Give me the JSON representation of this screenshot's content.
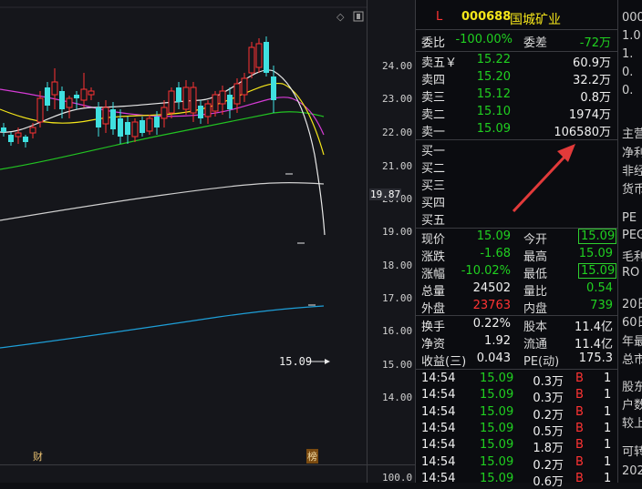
{
  "header": {
    "marker": "L",
    "code": "000688",
    "name": "国城矿业",
    "weibi_label": "委比",
    "weibi_value": "-100.00%",
    "weicha_label": "委差",
    "weicha_value": "-72万"
  },
  "asks": [
    {
      "label": "卖五￥",
      "price": "15.22",
      "vol": "60.9万"
    },
    {
      "label": "卖四",
      "price": "15.20",
      "vol": "32.2万"
    },
    {
      "label": "卖三",
      "price": "15.12",
      "vol": "0.8万"
    },
    {
      "label": "卖二",
      "price": "15.10",
      "vol": "1974万"
    },
    {
      "label": "卖一",
      "price": "15.09",
      "vol": "106580万"
    }
  ],
  "bids": [
    "买一",
    "买二",
    "买三",
    "买四",
    "买五"
  ],
  "stats": [
    {
      "l1": "现价",
      "v1": "15.09",
      "c1": "green",
      "l2": "今开",
      "v2": "15.09",
      "c2": "green",
      "b2": true
    },
    {
      "l1": "涨跌",
      "v1": "-1.68",
      "c1": "green",
      "l2": "最高",
      "v2": "15.09",
      "c2": "green",
      "b2": false
    },
    {
      "l1": "涨幅",
      "v1": "-10.02%",
      "c1": "green",
      "l2": "最低",
      "v2": "15.09",
      "c2": "green",
      "b2": true
    },
    {
      "l1": "总量",
      "v1": "24502",
      "c1": "white",
      "l2": "量比",
      "v2": "0.54",
      "c2": "green",
      "b2": false
    },
    {
      "l1": "外盘",
      "v1": "23763",
      "c1": "red",
      "l2": "内盘",
      "v2": "739",
      "c2": "green",
      "b2": false
    }
  ],
  "stats2": [
    {
      "l1": "换手",
      "v1": "0.22%",
      "l2": "股本",
      "v2": "11.4亿"
    },
    {
      "l1": "净资",
      "v1": "1.92",
      "l2": "流通",
      "v2": "11.4亿"
    },
    {
      "l1": "收益(三)",
      "v1": "0.043",
      "l2": "PE(动)",
      "v2": "175.3"
    }
  ],
  "ticks": [
    {
      "time": "14:54",
      "price": "15.09",
      "vol": "0.3万",
      "side": "B",
      "n": "1"
    },
    {
      "time": "14:54",
      "price": "15.09",
      "vol": "0.3万",
      "side": "B",
      "n": "1"
    },
    {
      "time": "14:54",
      "price": "15.09",
      "vol": "0.2万",
      "side": "B",
      "n": "1"
    },
    {
      "time": "14:54",
      "price": "15.09",
      "vol": "0.5万",
      "side": "B",
      "n": "1"
    },
    {
      "time": "14:54",
      "price": "15.09",
      "vol": "1.8万",
      "side": "B",
      "n": "1"
    },
    {
      "time": "14:54",
      "price": "15.09",
      "vol": "0.2万",
      "side": "B",
      "n": "1"
    },
    {
      "time": "14:54",
      "price": "15.09",
      "vol": "0.6万",
      "side": "B",
      "n": "1"
    }
  ],
  "axis_ticks": [
    "24.00",
    "23.00",
    "22.00",
    "21.00",
    "20.00",
    "19.00",
    "18.00",
    "17.00",
    "16.00",
    "15.00",
    "14.00"
  ],
  "axis_bottom": "100.0",
  "price_label": "19.87",
  "last_price_label": "15.09",
  "cai_label": "财",
  "bang_label": "榜",
  "side_texts": [
    "000",
    "1.0",
    "1.",
    "0.",
    "0.",
    "主营",
    "净利",
    "非经",
    "货币",
    "PE",
    "PEG",
    "毛利",
    "RO",
    "20日",
    "60日",
    "年最",
    "总市",
    "股东",
    "户数",
    "较上",
    "可转",
    "202"
  ],
  "colors": {
    "up": "#ff3333",
    "down": "#20d020",
    "ma5": "#e8e8e8",
    "ma10": "#f5e61a",
    "ma20": "#d63bd6",
    "ma60": "#22c322",
    "ma120": "#d0d0d0",
    "ma250": "#1e9fd8",
    "arrow": "#e23a3a"
  }
}
